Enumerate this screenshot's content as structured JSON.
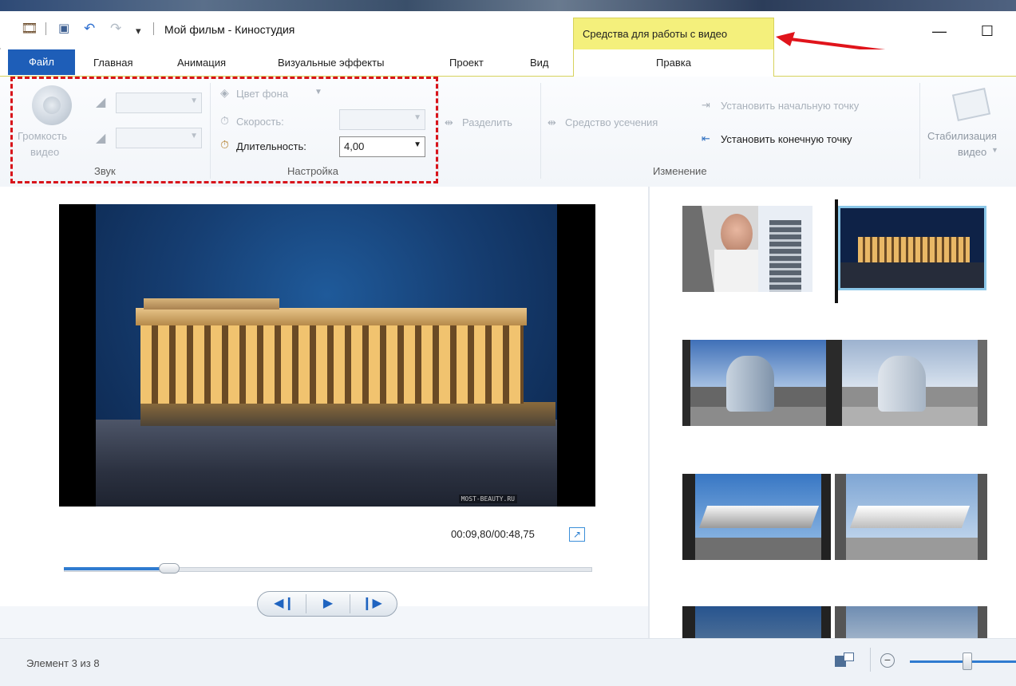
{
  "titlebar": {
    "title": "Мой фильм - Киностудия",
    "contextual_group": "Средства для работы с видео",
    "minimize": "—",
    "maximize": "☐"
  },
  "tabs": {
    "file": "Файл",
    "home": "Главная",
    "animation": "Анимация",
    "visual_effects": "Визуальные эффекты",
    "project": "Проект",
    "view": "Вид",
    "edit": "Правка"
  },
  "ribbon": {
    "sound": {
      "volume_line1": "Громкость",
      "volume_line2": "видео",
      "group_label": "Звук"
    },
    "settings": {
      "bg_color": "Цвет фона",
      "speed": "Скорость:",
      "duration": "Длительность:",
      "duration_value": "4,00",
      "group_label": "Настройка"
    },
    "edit": {
      "split": "Разделить",
      "trim": "Средство усечения",
      "set_start": "Установить начальную точку",
      "set_end": "Установить конечную точку",
      "group_label": "Изменение"
    },
    "stabilization": {
      "line1": "Стабилизация",
      "line2": "видео"
    }
  },
  "preview": {
    "watermark": "MOST-BEAUTY.RU",
    "timecode": "00:09,80/00:48,75",
    "seek_progress_percent": 20
  },
  "status": {
    "item_text": "Элемент 3 из 8",
    "zoom_percent": 55
  },
  "colors": {
    "accent": "#1e5eb8",
    "context_tab": "#f4f07c",
    "highlight": "#d8141b"
  }
}
